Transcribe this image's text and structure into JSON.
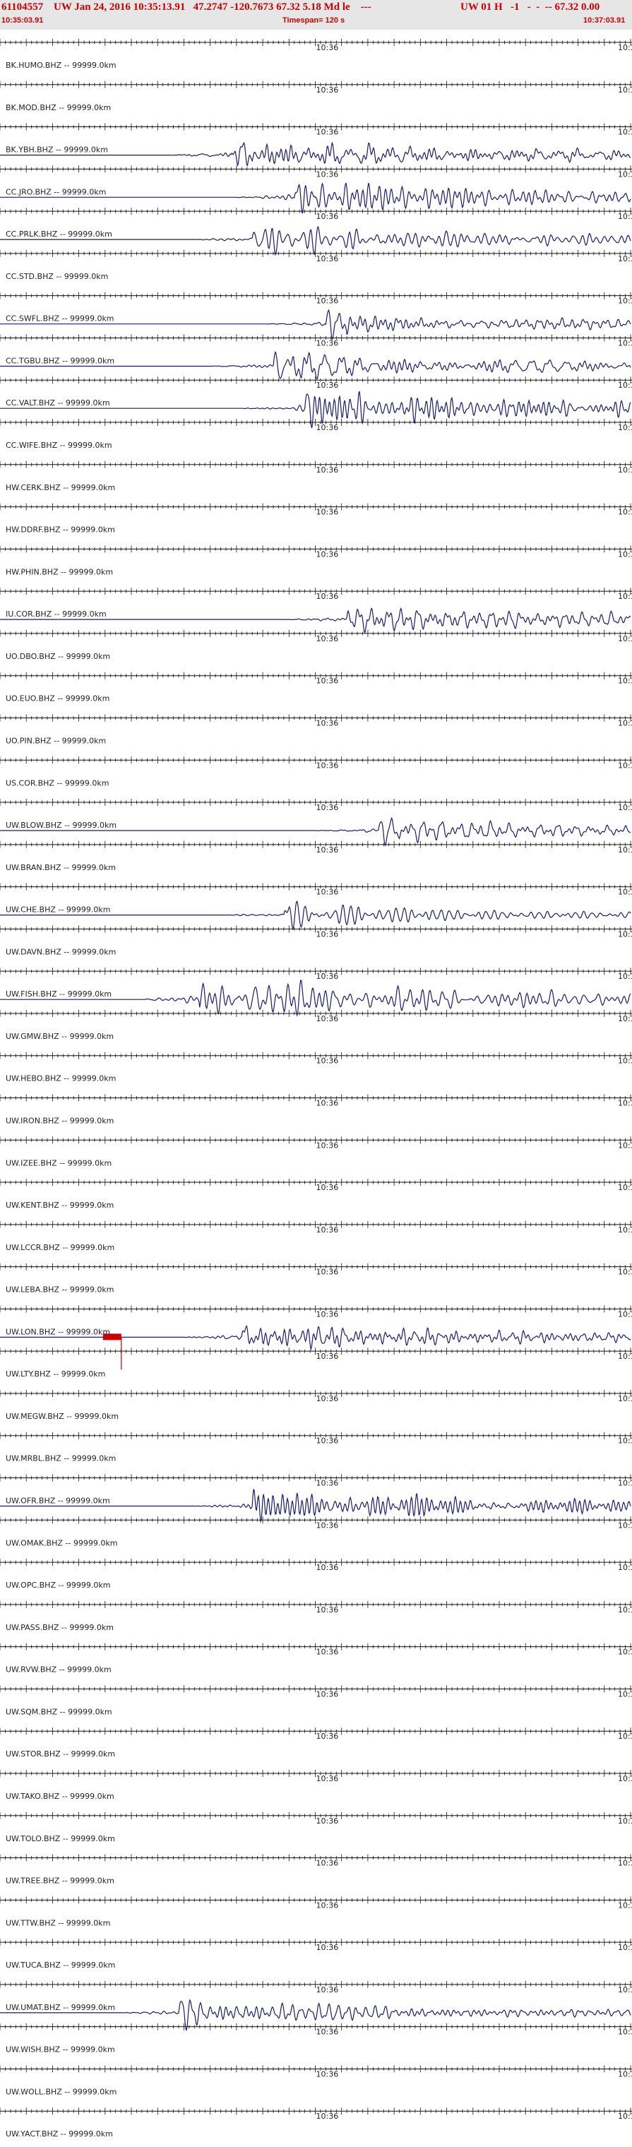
{
  "header": {
    "event_id": "61104557",
    "event_info": "UW Jan 24, 2016 10:35:13.91   47.2747 -120.7673 67.32 5.18 Md le    ---",
    "net_flags": "UW 01 H   -1   -  -  -- 67.32 0.00",
    "start_time": "10:35:03.91",
    "timespan": "Timespan= 120 s",
    "end_time": "10:37:03.91"
  },
  "chart_data": {
    "type": "line",
    "title": "",
    "xlabel": "",
    "ylabel": "",
    "x_range_s": [
      0,
      120
    ],
    "mid_time_label": "10:36",
    "right_time_label": "10:3",
    "grid": false,
    "legend": "none",
    "trace_color": "#1a1a6e",
    "pick_color": "#cc0000",
    "channels": [
      {
        "label": "BK.HUMO.BHZ -- 99999.0km",
        "active": false
      },
      {
        "label": "BK.MOD.BHZ -- 99999.0km",
        "active": false
      },
      {
        "label": "BK.YBH.BHZ -- 99999.0km",
        "active": true,
        "onset_s": 44,
        "amp": 0.9
      },
      {
        "label": "CC.JRO.BHZ -- 99999.0km",
        "active": true,
        "onset_s": 56,
        "amp": 0.9
      },
      {
        "label": "CC.PRLK.BHZ -- 99999.0km",
        "active": true,
        "onset_s": 48,
        "amp": 0.9
      },
      {
        "label": "CC.STD.BHZ -- 99999.0km",
        "active": false
      },
      {
        "label": "CC.SWFL.BHZ -- 99999.0km",
        "active": true,
        "onset_s": 62,
        "amp": 0.9
      },
      {
        "label": "CC.TGBU.BHZ -- 99999.0km",
        "active": true,
        "onset_s": 52,
        "amp": 0.9
      },
      {
        "label": "CC.VALT.BHZ -- 99999.0km",
        "active": true,
        "onset_s": 58,
        "amp": 0.9
      },
      {
        "label": "CC.WIFE.BHZ -- 99999.0km",
        "active": false
      },
      {
        "label": "HW.CERK.BHZ -- 99999.0km",
        "active": false
      },
      {
        "label": "HW.DDRF.BHZ -- 99999.0km",
        "active": false
      },
      {
        "label": "HW.PHIN.BHZ -- 99999.0km",
        "active": false
      },
      {
        "label": "IU.COR.BHZ -- 99999.0km",
        "active": true,
        "onset_s": 66,
        "amp": 0.9
      },
      {
        "label": "UO.DBO.BHZ -- 99999.0km",
        "active": false
      },
      {
        "label": "UO.EUO.BHZ -- 99999.0km",
        "active": false
      },
      {
        "label": "UO.PIN.BHZ -- 99999.0km",
        "active": false
      },
      {
        "label": "US.COR.BHZ -- 99999.0km",
        "active": false
      },
      {
        "label": "UW.BLOW.BHZ -- 99999.0km",
        "active": true,
        "onset_s": 72,
        "amp": 0.8
      },
      {
        "label": "UW.BRAN.BHZ -- 99999.0km",
        "active": false
      },
      {
        "label": "UW.CHE.BHZ -- 99999.0km",
        "active": true,
        "onset_s": 54,
        "amp": 0.8
      },
      {
        "label": "UW.DAVN.BHZ -- 99999.0km",
        "active": false
      },
      {
        "label": "UW.FISH.BHZ -- 99999.0km",
        "active": true,
        "onset_s": 38,
        "amp": 1.0
      },
      {
        "label": "UW.GMW.BHZ -- 99999.0km",
        "active": false
      },
      {
        "label": "UW.HEBO.BHZ -- 99999.0km",
        "active": false
      },
      {
        "label": "UW.IRON.BHZ -- 99999.0km",
        "active": false
      },
      {
        "label": "UW.IZEE.BHZ -- 99999.0km",
        "active": false
      },
      {
        "label": "UW.KENT.BHZ -- 99999.0km",
        "active": false
      },
      {
        "label": "UW.LCCR.BHZ -- 99999.0km",
        "active": false
      },
      {
        "label": "UW.LEBA.BHZ -- 99999.0km",
        "active": false
      },
      {
        "label": "UW.LON.BHZ -- 99999.0km",
        "active": true,
        "onset_s": 46,
        "amp": 0.9,
        "pick_s": 20
      },
      {
        "label": "UW.LTY.BHZ -- 99999.0km",
        "active": false
      },
      {
        "label": "UW.MEGW.BHZ -- 99999.0km",
        "active": false
      },
      {
        "label": "UW.MRBL.BHZ -- 99999.0km",
        "active": false
      },
      {
        "label": "UW.OFR.BHZ -- 99999.0km",
        "active": true,
        "onset_s": 48,
        "amp": 1.0
      },
      {
        "label": "UW.OMAK.BHZ -- 99999.0km",
        "active": false
      },
      {
        "label": "UW.OPC.BHZ -- 99999.0km",
        "active": false
      },
      {
        "label": "UW.PASS.BHZ -- 99999.0km",
        "active": false
      },
      {
        "label": "UW.RVW.BHZ -- 99999.0km",
        "active": false
      },
      {
        "label": "UW.SQM.BHZ -- 99999.0km",
        "active": false
      },
      {
        "label": "UW.STOR.BHZ -- 99999.0km",
        "active": false
      },
      {
        "label": "UW.TAKO.BHZ -- 99999.0km",
        "active": false
      },
      {
        "label": "UW.TOLO.BHZ -- 99999.0km",
        "active": false
      },
      {
        "label": "UW.TREE.BHZ -- 99999.0km",
        "active": false
      },
      {
        "label": "UW.TTW.BHZ -- 99999.0km",
        "active": false
      },
      {
        "label": "UW.TUCA.BHZ -- 99999.0km",
        "active": false
      },
      {
        "label": "UW.UMAT.BHZ -- 99999.0km",
        "active": true,
        "onset_s": 34,
        "amp": 0.9
      },
      {
        "label": "UW.WISH.BHZ -- 99999.0km",
        "active": false
      },
      {
        "label": "UW.WOLL.BHZ -- 99999.0km",
        "active": false
      },
      {
        "label": "UW.YACT.BHZ -- 99999.0km",
        "active": false
      }
    ]
  }
}
